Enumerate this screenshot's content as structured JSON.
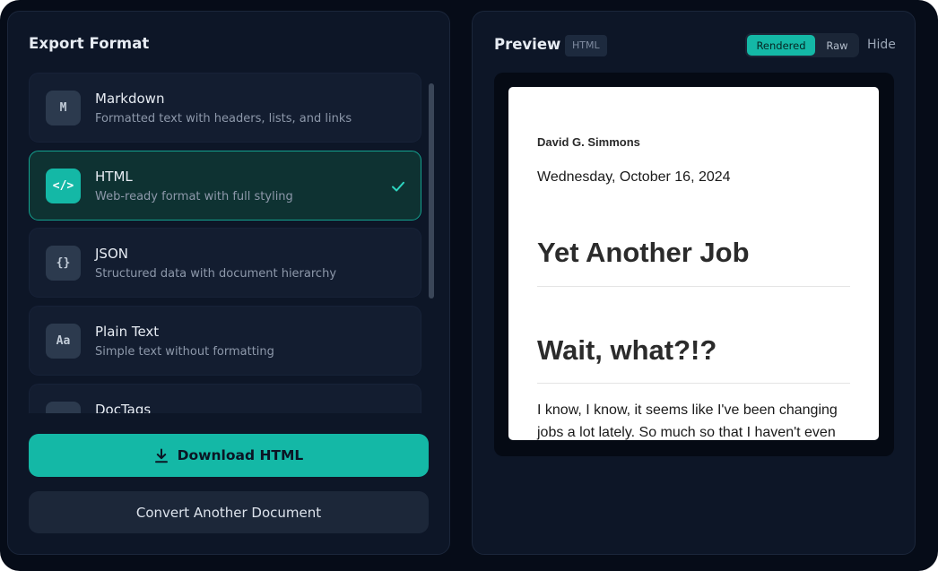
{
  "export_panel": {
    "title": "Export Format",
    "formats": [
      {
        "icon": "M",
        "icon_name": "markdown-icon",
        "name": "Markdown",
        "description": "Formatted text with headers, lists, and links",
        "selected": false
      },
      {
        "icon": "</>",
        "icon_name": "code-icon",
        "name": "HTML",
        "description": "Web-ready format with full styling",
        "selected": true
      },
      {
        "icon": "{}",
        "icon_name": "braces-icon",
        "name": "JSON",
        "description": "Structured data with document hierarchy",
        "selected": false
      },
      {
        "icon": "Aa",
        "icon_name": "text-icon",
        "name": "Plain Text",
        "description": "Simple text without formatting",
        "selected": false
      },
      {
        "icon": "",
        "icon_name": "tags-icon",
        "name": "DocTags",
        "description": "",
        "selected": false
      }
    ],
    "download_label": "Download HTML",
    "convert_label": "Convert Another Document"
  },
  "preview": {
    "title": "Preview",
    "format_badge": "HTML",
    "toggle": {
      "rendered_label": "Rendered",
      "raw_label": "Raw",
      "active": "Rendered"
    },
    "hide_label": "Hide",
    "document": {
      "author": "David G. Simmons",
      "date": "Wednesday, October 16, 2024",
      "heading_1": "Yet Another Job",
      "heading_2": "Wait, what?!?",
      "body": "I know, I know, it seems like I've been changing jobs a lot lately. So much so that I haven't even"
    }
  },
  "colors": {
    "accent": "#14b8a6",
    "background": "#060c18",
    "panel": "#0d1627"
  }
}
